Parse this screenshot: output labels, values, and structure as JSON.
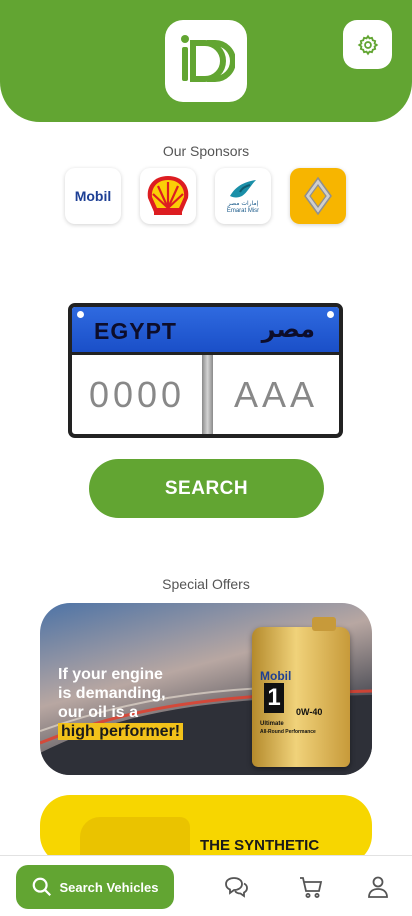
{
  "header": {
    "logo_icon": "dd-logo-icon",
    "settings_icon": "gear-icon",
    "brand_color": "#62a532"
  },
  "sponsors": {
    "title": "Our Sponsors",
    "items": [
      {
        "name": "Mobil",
        "label": "Mobil"
      },
      {
        "name": "Shell"
      },
      {
        "name": "Emarat Misr",
        "label_ar": "إمارات مصر",
        "label_en": "Emarat Misr"
      },
      {
        "name": "Renault"
      }
    ]
  },
  "plate": {
    "country": "EGYPT",
    "country_ar": "مصر",
    "numbers_placeholder": "0000",
    "letters_placeholder": "AAA"
  },
  "search_button": {
    "label": "SEARCH"
  },
  "offers": {
    "title": "Special Offers",
    "banner1": {
      "line1": "If your engine",
      "line2": "is demanding,",
      "line3": "our oil is a",
      "line4": "high performer!",
      "product_brand": "Mobil",
      "product_number": "1",
      "product_grade": "0W-40",
      "product_line1": "Ultimate",
      "product_line2": "All-Round Performance"
    },
    "banner2": {
      "text": "THE SYNTHETIC"
    }
  },
  "bottom_nav": {
    "search_label": "Search Vehicles",
    "icons": [
      "search-icon",
      "chat-icon",
      "cart-icon",
      "user-icon"
    ]
  }
}
